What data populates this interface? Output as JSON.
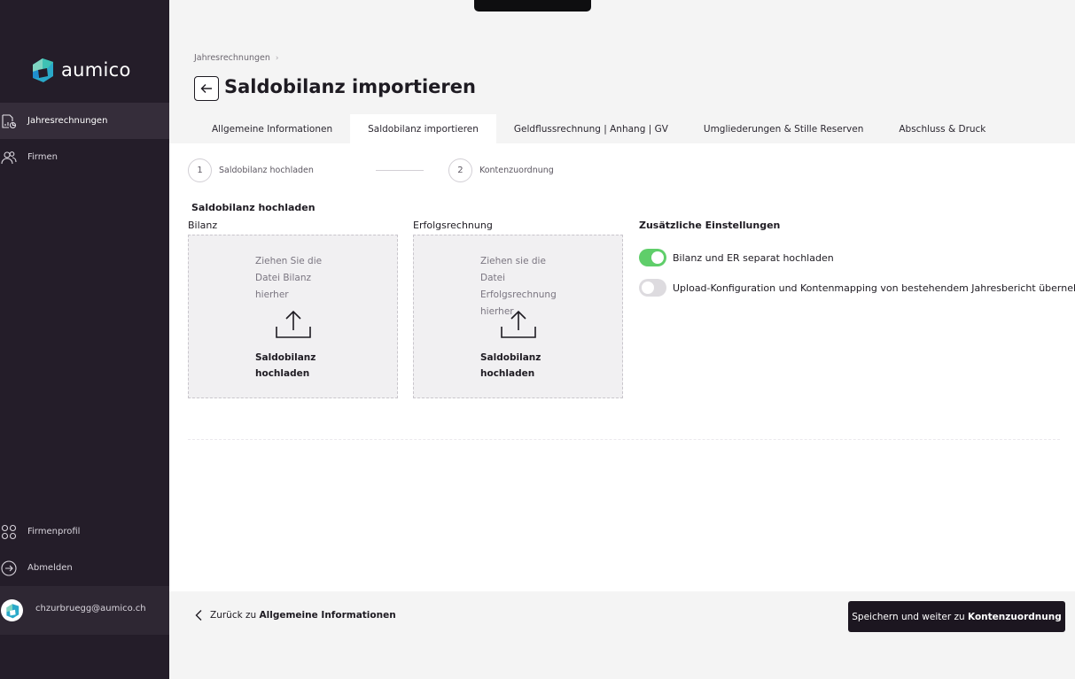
{
  "brand": {
    "name": "aumico",
    "logo_colors": [
      "#3ec1b4",
      "#1f8fcf",
      "#7fd4c1"
    ]
  },
  "nav": {
    "items": [
      {
        "label": "Jahresrechnungen",
        "icon": "document-chart-icon",
        "active": true
      },
      {
        "label": "Firmen",
        "icon": "users-icon",
        "active": false
      }
    ],
    "bottom_items": [
      {
        "label": "Firmenprofil",
        "icon": "grid-dots-icon"
      },
      {
        "label": "Abmelden",
        "icon": "logout-icon"
      }
    ],
    "user": {
      "email": "chzurbruegg@aumico.ch"
    }
  },
  "header": {
    "breadcrumb": [
      "Jahresrechnungen"
    ],
    "title": "Saldobilanz importieren"
  },
  "tabs": [
    {
      "label": "Allgemeine Informationen",
      "active": false
    },
    {
      "label": "Saldobilanz importieren",
      "active": true
    },
    {
      "label": "Geldflussrechnung | Anhang | GV",
      "active": false
    },
    {
      "label": "Umgliederungen & Stille Reserven",
      "active": false
    },
    {
      "label": "Abschluss & Druck",
      "active": false
    }
  ],
  "steps": [
    {
      "number": "1",
      "label": "Saldobilanz hochladen"
    },
    {
      "number": "2",
      "label": "Kontenzuordnung"
    }
  ],
  "upload": {
    "section_title": "Saldobilanz hochladen",
    "boxes": [
      {
        "label": "Bilanz",
        "hint": "Ziehen Sie die Datei Bilanz hierher",
        "action": "Saldobilanz hochladen"
      },
      {
        "label": "Erfolgsrechnung",
        "hint": "Ziehen sie die Datei Erfolgsrechnung hierher",
        "action": "Saldobilanz hochladen"
      }
    ]
  },
  "settings": {
    "title": "Zusätzliche Einstellungen",
    "options": [
      {
        "label": "Bilanz und ER separat hochladen",
        "enabled": true
      },
      {
        "label": "Upload-Konfiguration und Kontenmapping von bestehendem Jahresbericht übernehmen",
        "enabled": false
      }
    ]
  },
  "footer": {
    "back_prefix": "Zurück zu",
    "back_target": "Allgemeine Informationen",
    "next_prefix": "Speichern und weiter zu",
    "next_target": "Kontenzuordnung"
  },
  "colors": {
    "sidebar": "#241d29",
    "toggle_on": "#5fce6a",
    "primary_button": "#1c1620"
  }
}
